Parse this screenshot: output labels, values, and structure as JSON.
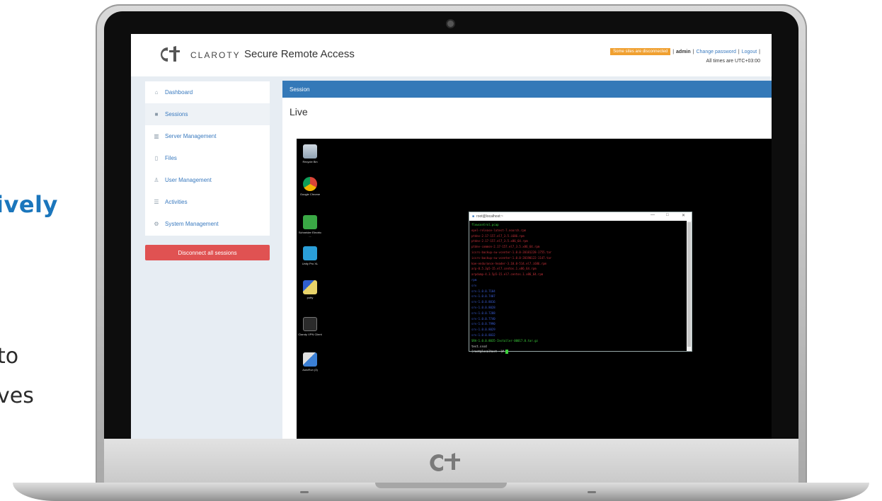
{
  "background": {
    "headline": "ively",
    "line1": "to",
    "line2": "ves"
  },
  "app": {
    "brand": "CLAROTY",
    "title": "Secure Remote Access",
    "header": {
      "warning": "Some sites are disconnected",
      "user": "admin",
      "change_password": "Change password",
      "logout": "Logout",
      "timezone": "All times are UTC+03:00",
      "separator": "|"
    },
    "sidebar": {
      "items": [
        {
          "label": "Dashboard",
          "icon": "home-icon"
        },
        {
          "label": "Sessions",
          "icon": "video-icon"
        },
        {
          "label": "Server Management",
          "icon": "building-icon"
        },
        {
          "label": "Files",
          "icon": "file-icon"
        },
        {
          "label": "User Management",
          "icon": "user-icon"
        },
        {
          "label": "Activities",
          "icon": "list-icon"
        },
        {
          "label": "System Management",
          "icon": "gear-icon"
        }
      ],
      "disconnect_label": "Disconnect all sessions"
    },
    "content": {
      "tab_label": "Session",
      "heading": "Live"
    },
    "desktop": {
      "icons": [
        {
          "label": "Recycle Bin"
        },
        {
          "label": "Google Chrome"
        },
        {
          "label": "Schneider Electric ..."
        },
        {
          "label": "Unity Pro XL"
        },
        {
          "label": "putty"
        },
        {
          "label": "Claroty VPN Client"
        },
        {
          "label": "AutoRun (3)"
        }
      ]
    },
    "terminal": {
      "title": "root@localhost:~",
      "controls": {
        "minimize": "—",
        "maximize": "□",
        "close": "✕"
      },
      "lines": [
        {
          "text": "flowcontrol.pcap",
          "color": "green"
        },
        {
          "text": "epel-release-latest-7.noarch.rpm",
          "color": "red"
        },
        {
          "text": "ptdev-2.17-157.el7_3.5.i686.rpm",
          "color": "red"
        },
        {
          "text": "ptdev-2.17-157.el7_3.5.x86_64.rpm",
          "color": "red"
        },
        {
          "text": "ptdev-common-2.17-157.el7_3.5.x86_64.rpm",
          "color": "red"
        },
        {
          "text": "icsrs-backup-sw-vcenter-1.0.0-20181228-1755.tar",
          "color": "red"
        },
        {
          "text": "icsrs-backup-sw-vcenter-1.0.0-20190122-1147.tar",
          "color": "red"
        },
        {
          "text": "kae-endurance-header-3.10.0-514.el7.i686.rpm",
          "color": "red"
        },
        {
          "text": "arp-0.5.3p5-15.el7.centos.1.x86_64.rpm",
          "color": "red"
        },
        {
          "text": "arpdump-4.3.5p5-15.el7.centos.1.x86_64.rpm",
          "color": "red"
        },
        {
          "text": "rpm",
          "color": "blue"
        },
        {
          "text": "srv",
          "color": "blue"
        },
        {
          "text": "srv-1.0.0.7104",
          "color": "blue"
        },
        {
          "text": "srv-1.0.0.7407",
          "color": "blue"
        },
        {
          "text": "srv-1.0.0.8016",
          "color": "blue"
        },
        {
          "text": "srv-1.0.0.8028",
          "color": "blue"
        },
        {
          "text": "srv-1.0.0.7288",
          "color": "blue"
        },
        {
          "text": "srv-1.0.0.7740",
          "color": "blue"
        },
        {
          "text": "srv-1.0.0.7990",
          "color": "blue"
        },
        {
          "text": "srv-1.0.0.8029",
          "color": "blue"
        },
        {
          "text": "srv-1.0.0.8032",
          "color": "blue"
        },
        {
          "text": "SRA-1.0.0.8035-Installer-00017.0.tar.gz",
          "color": "green"
        },
        {
          "text": "test.sssd",
          "color": "white"
        }
      ],
      "prompt": "[root@localhost ~]# "
    }
  },
  "colors": {
    "accent": "#3479b8",
    "headline": "#1b76bc",
    "danger": "#e05252",
    "warning": "#f0a030"
  }
}
